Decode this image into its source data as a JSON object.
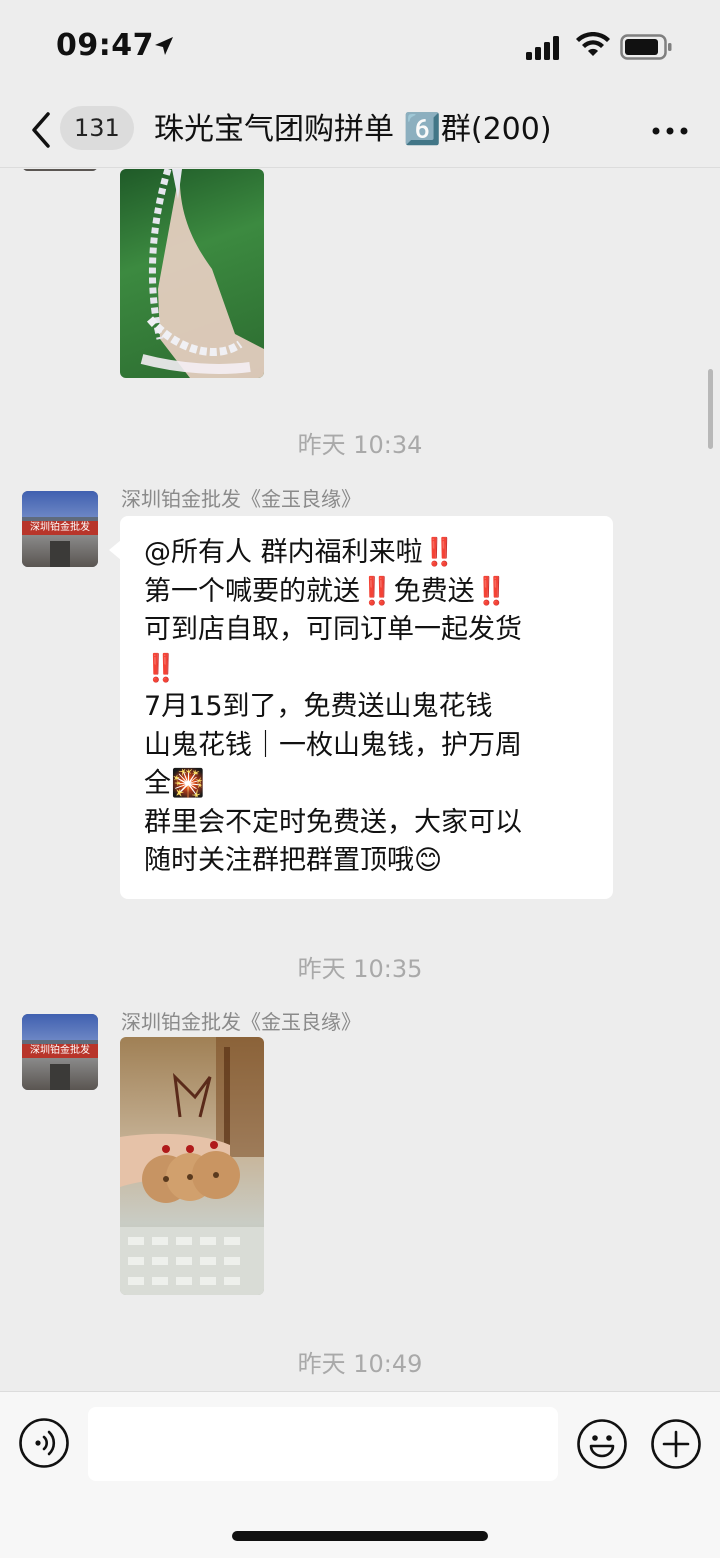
{
  "status_bar": {
    "time": "09:47"
  },
  "nav": {
    "unread_count": "131",
    "title": "珠光宝气团购拼单 6️⃣群(200)"
  },
  "messages": {
    "timestamp_1": "昨天 10:34",
    "timestamp_2": "昨天 10:35",
    "timestamp_3": "昨天 10:49",
    "sender_1": "深圳铂金批发《金玉良缘》",
    "sender_2": "深圳铂金批发《金玉良缘》",
    "avatar_sign_text": "深圳铂金批发",
    "text_lines": [
      "@所有人 群内福利来啦‼️",
      "第一个喊要的就送‼️免费送‼️",
      "可到店自取，可同订单一起发货",
      "‼️",
      "7月15到了，免费送山鬼花钱",
      "山鬼花钱｜一枚山鬼钱，护万周",
      "全🎇",
      "群里会不定时免费送，大家可以",
      "随时关注群把群置顶哦😊"
    ]
  },
  "input_bar": {
    "value": "",
    "placeholder": ""
  },
  "icons": {
    "back": "chevron-left-icon",
    "more": "more-horizontal-icon",
    "voice": "voice-icon",
    "emoji": "emoji-icon",
    "plus": "plus-icon"
  }
}
